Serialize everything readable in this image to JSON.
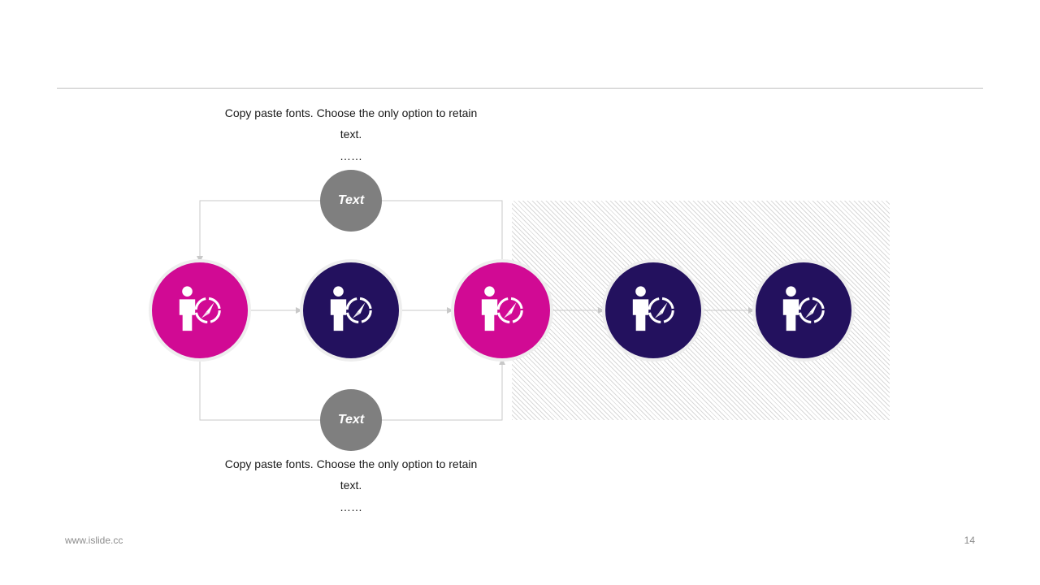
{
  "diagram": {
    "top_note": {
      "text": "Copy paste fonts. Choose the only option to retain text.",
      "ellipsis": "……"
    },
    "bottom_note": {
      "text": "Copy paste fonts. Choose the only option to retain text.",
      "ellipsis": "……"
    },
    "top_label": "Text",
    "bottom_label": "Text",
    "nodes": [
      {
        "color": "#d10a94",
        "icon": "businessman-compass-icon"
      },
      {
        "color": "#23115e",
        "icon": "businessman-compass-icon"
      },
      {
        "color": "#d10a94",
        "icon": "businessman-compass-icon"
      },
      {
        "color": "#23115e",
        "icon": "businessman-compass-icon"
      },
      {
        "color": "#23115e",
        "icon": "businessman-compass-icon"
      }
    ],
    "label_color": "#7f7f7f",
    "connector_color": "#c8c8c8"
  },
  "footer": {
    "website": "www.islide.cc",
    "page_number": "14"
  }
}
